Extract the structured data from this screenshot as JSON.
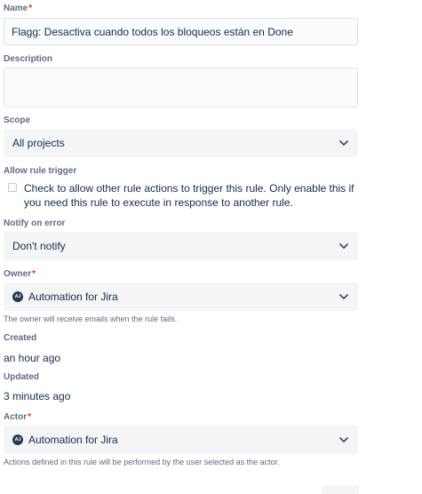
{
  "name": {
    "label": "Name",
    "required_mark": "*",
    "value": "Flagg: Desactiva cuando todos los bloqueos están en Done"
  },
  "description": {
    "label": "Description",
    "value": ""
  },
  "scope": {
    "label": "Scope",
    "value": "All projects"
  },
  "allow_rule_trigger": {
    "label": "Allow rule trigger",
    "checked": false,
    "text": "Check to allow other rule actions to trigger this rule. Only enable this if you need this rule to execute in response to another rule."
  },
  "notify_on_error": {
    "label": "Notify on error",
    "value": "Don't notify"
  },
  "owner": {
    "label": "Owner",
    "required_mark": "*",
    "avatar_initials": "AJ",
    "value": "Automation for Jira",
    "helper": "The owner will receive emails when the rule fails."
  },
  "created": {
    "label": "Created",
    "value": "an hour ago"
  },
  "updated": {
    "label": "Updated",
    "value": "3 minutes ago"
  },
  "actor": {
    "label": "Actor",
    "required_mark": "*",
    "avatar_initials": "AJ",
    "value": "Automation for Jira",
    "helper": "Actions defined in this rule will be performed by the user selected as the actor."
  },
  "colors": {
    "label": "#5e6c84",
    "text": "#172b4d",
    "required": "#de350b",
    "field_bg": "#f4f5f7",
    "input_bg": "#fafbfc",
    "border": "#dfe1e6"
  },
  "icons": [
    "chevron-down-icon",
    "avatar-icon"
  ]
}
